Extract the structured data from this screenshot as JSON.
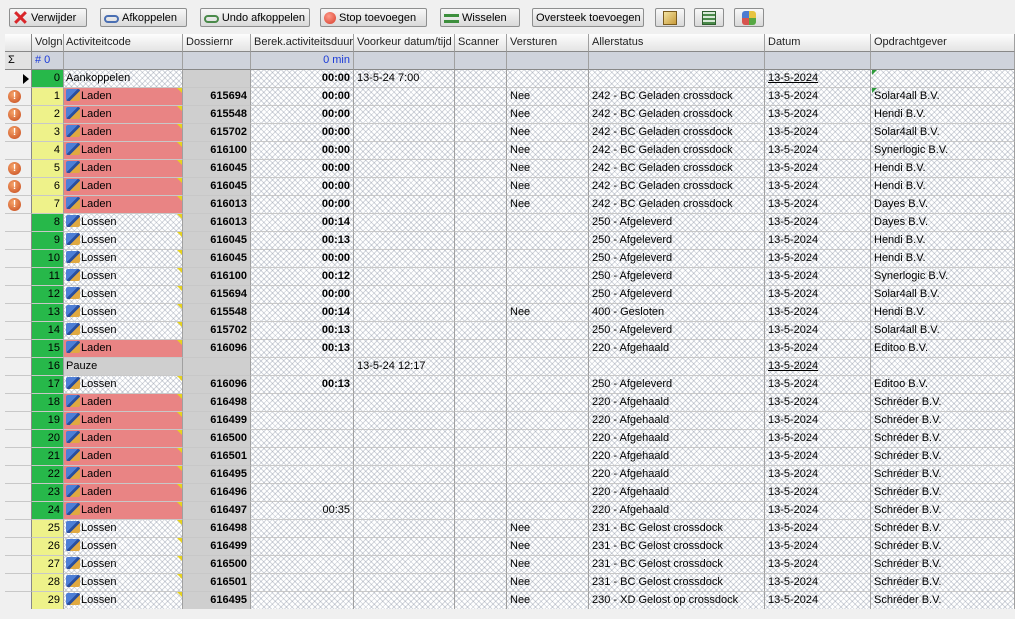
{
  "toolbar": {
    "buttons": [
      {
        "label": "Verwijder",
        "icon": "delete-icon"
      },
      {
        "label": "Afkoppelen",
        "icon": "uncouple-icon"
      },
      {
        "label": "Undo afkoppelen",
        "icon": "undo-uncouple-icon"
      },
      {
        "label": "Stop toevoegen",
        "icon": "stop-icon"
      },
      {
        "label": "Wisselen",
        "icon": "swap-icon"
      },
      {
        "label": "Oversteek toevoegen",
        "icon": ""
      },
      {
        "label": "",
        "icon": "document-icon"
      },
      {
        "label": "",
        "icon": "grid-icon"
      },
      {
        "label": "",
        "icon": "palette-icon"
      }
    ]
  },
  "grid": {
    "columns": [
      "Volgnr",
      "Activiteitcode",
      "Dossiernr",
      "Berek.activiteitsduur",
      "Voorkeur datum/tijd",
      "Scanner",
      "Versturen",
      "Allerstatus",
      "Datum",
      "Opdrachtgever"
    ],
    "summary": {
      "sigma": "Σ",
      "volg": "# 0",
      "duur": "0 min"
    },
    "rows": [
      {
        "volg": "0",
        "act": "Aankoppelen",
        "dos": "",
        "duur": "00:00",
        "voorkeur": "13-5-24 7:00",
        "versturen": "",
        "status": "",
        "datum": "13-5-2024",
        "opdrachtgever": "",
        "volgColor": "green",
        "actColor": "none",
        "warn": false,
        "truck": false,
        "current": true,
        "dateUnderline": true
      },
      {
        "volg": "1",
        "act": "Laden",
        "dos": "615694",
        "duur": "00:00",
        "voorkeur": "",
        "versturen": "Nee",
        "status": "242 - BC Geladen crossdock",
        "datum": "13-5-2024",
        "opdrachtgever": "Solar4all B.V.",
        "volgColor": "yellow",
        "actColor": "red",
        "warn": true,
        "truck": true
      },
      {
        "volg": "2",
        "act": "Laden",
        "dos": "615548",
        "duur": "00:00",
        "voorkeur": "",
        "versturen": "Nee",
        "status": "242 - BC Geladen crossdock",
        "datum": "13-5-2024",
        "opdrachtgever": "Hendi B.V.",
        "volgColor": "yellow",
        "actColor": "red",
        "warn": true,
        "truck": true
      },
      {
        "volg": "3",
        "act": "Laden",
        "dos": "615702",
        "duur": "00:00",
        "voorkeur": "",
        "versturen": "Nee",
        "status": "242 - BC Geladen crossdock",
        "datum": "13-5-2024",
        "opdrachtgever": "Solar4all B.V.",
        "volgColor": "yellow",
        "actColor": "red",
        "warn": true,
        "truck": true
      },
      {
        "volg": "4",
        "act": "Laden",
        "dos": "616100",
        "duur": "00:00",
        "voorkeur": "",
        "versturen": "Nee",
        "status": "242 - BC Geladen crossdock",
        "datum": "13-5-2024",
        "opdrachtgever": "Synerlogic B.V.",
        "volgColor": "yellow",
        "actColor": "red",
        "warn": false,
        "truck": true
      },
      {
        "volg": "5",
        "act": "Laden",
        "dos": "616045",
        "duur": "00:00",
        "voorkeur": "",
        "versturen": "Nee",
        "status": "242 - BC Geladen crossdock",
        "datum": "13-5-2024",
        "opdrachtgever": "Hendi B.V.",
        "volgColor": "yellow",
        "actColor": "red",
        "warn": true,
        "truck": true
      },
      {
        "volg": "6",
        "act": "Laden",
        "dos": "616045",
        "duur": "00:00",
        "voorkeur": "",
        "versturen": "Nee",
        "status": "242 - BC Geladen crossdock",
        "datum": "13-5-2024",
        "opdrachtgever": "Hendi B.V.",
        "volgColor": "yellow",
        "actColor": "red",
        "warn": true,
        "truck": true
      },
      {
        "volg": "7",
        "act": "Laden",
        "dos": "616013",
        "duur": "00:00",
        "voorkeur": "",
        "versturen": "Nee",
        "status": "242 - BC Geladen crossdock",
        "datum": "13-5-2024",
        "opdrachtgever": "Dayes B.V.",
        "volgColor": "yellow",
        "actColor": "red",
        "warn": true,
        "truck": true
      },
      {
        "volg": "8",
        "act": "Lossen",
        "dos": "616013",
        "duur": "00:14",
        "voorkeur": "",
        "versturen": "",
        "status": "250 - Afgeleverd",
        "datum": "13-5-2024",
        "opdrachtgever": "Dayes B.V.",
        "volgColor": "green",
        "actColor": "none",
        "warn": false,
        "truck": true
      },
      {
        "volg": "9",
        "act": "Lossen",
        "dos": "616045",
        "duur": "00:13",
        "voorkeur": "",
        "versturen": "",
        "status": "250 - Afgeleverd",
        "datum": "13-5-2024",
        "opdrachtgever": "Hendi B.V.",
        "volgColor": "green",
        "actColor": "none",
        "warn": false,
        "truck": true
      },
      {
        "volg": "10",
        "act": "Lossen",
        "dos": "616045",
        "duur": "00:00",
        "voorkeur": "",
        "versturen": "",
        "status": "250 - Afgeleverd",
        "datum": "13-5-2024",
        "opdrachtgever": "Hendi B.V.",
        "volgColor": "green",
        "actColor": "none",
        "warn": false,
        "truck": true
      },
      {
        "volg": "11",
        "act": "Lossen",
        "dos": "616100",
        "duur": "00:12",
        "voorkeur": "",
        "versturen": "",
        "status": "250 - Afgeleverd",
        "datum": "13-5-2024",
        "opdrachtgever": "Synerlogic B.V.",
        "volgColor": "green",
        "actColor": "none",
        "warn": false,
        "truck": true
      },
      {
        "volg": "12",
        "act": "Lossen",
        "dos": "615694",
        "duur": "00:00",
        "voorkeur": "",
        "versturen": "",
        "status": "250 - Afgeleverd",
        "datum": "13-5-2024",
        "opdrachtgever": "Solar4all B.V.",
        "volgColor": "green",
        "actColor": "none",
        "warn": false,
        "truck": true
      },
      {
        "volg": "13",
        "act": "Lossen",
        "dos": "615548",
        "duur": "00:14",
        "voorkeur": "",
        "versturen": "Nee",
        "status": "400 - Gesloten",
        "datum": "13-5-2024",
        "opdrachtgever": "Hendi B.V.",
        "volgColor": "green",
        "actColor": "none",
        "warn": false,
        "truck": true
      },
      {
        "volg": "14",
        "act": "Lossen",
        "dos": "615702",
        "duur": "00:13",
        "voorkeur": "",
        "versturen": "",
        "status": "250 - Afgeleverd",
        "datum": "13-5-2024",
        "opdrachtgever": "Solar4all B.V.",
        "volgColor": "green",
        "actColor": "none",
        "warn": false,
        "truck": true
      },
      {
        "volg": "15",
        "act": "Laden",
        "dos": "616096",
        "duur": "00:13",
        "voorkeur": "",
        "versturen": "",
        "status": "220 - Afgehaald",
        "datum": "13-5-2024",
        "opdrachtgever": "Editoo B.V.",
        "volgColor": "green",
        "actColor": "red",
        "warn": false,
        "truck": true
      },
      {
        "volg": "16",
        "act": "Pauze",
        "dos": "",
        "duur": "",
        "voorkeur": "13-5-24 12:17",
        "versturen": "",
        "status": "",
        "datum": "13-5-2024",
        "opdrachtgever": "",
        "volgColor": "green",
        "actColor": "grey",
        "warn": false,
        "truck": false,
        "dateUnderline": true
      },
      {
        "volg": "17",
        "act": "Lossen",
        "dos": "616096",
        "duur": "00:13",
        "voorkeur": "",
        "versturen": "",
        "status": "250 - Afgeleverd",
        "datum": "13-5-2024",
        "opdrachtgever": "Editoo B.V.",
        "volgColor": "green",
        "actColor": "none",
        "warn": false,
        "truck": true
      },
      {
        "volg": "18",
        "act": "Laden",
        "dos": "616498",
        "duur": "",
        "voorkeur": "",
        "versturen": "",
        "status": "220 - Afgehaald",
        "datum": "13-5-2024",
        "opdrachtgever": "Schréder B.V.",
        "volgColor": "green",
        "actColor": "red",
        "warn": false,
        "truck": true
      },
      {
        "volg": "19",
        "act": "Laden",
        "dos": "616499",
        "duur": "",
        "voorkeur": "",
        "versturen": "",
        "status": "220 - Afgehaald",
        "datum": "13-5-2024",
        "opdrachtgever": "Schréder B.V.",
        "volgColor": "green",
        "actColor": "red",
        "warn": false,
        "truck": true
      },
      {
        "volg": "20",
        "act": "Laden",
        "dos": "616500",
        "duur": "",
        "voorkeur": "",
        "versturen": "",
        "status": "220 - Afgehaald",
        "datum": "13-5-2024",
        "opdrachtgever": "Schréder B.V.",
        "volgColor": "green",
        "actColor": "red",
        "warn": false,
        "truck": true
      },
      {
        "volg": "21",
        "act": "Laden",
        "dos": "616501",
        "duur": "",
        "voorkeur": "",
        "versturen": "",
        "status": "220 - Afgehaald",
        "datum": "13-5-2024",
        "opdrachtgever": "Schréder B.V.",
        "volgColor": "green",
        "actColor": "red",
        "warn": false,
        "truck": true
      },
      {
        "volg": "22",
        "act": "Laden",
        "dos": "616495",
        "duur": "",
        "voorkeur": "",
        "versturen": "",
        "status": "220 - Afgehaald",
        "datum": "13-5-2024",
        "opdrachtgever": "Schréder B.V.",
        "volgColor": "green",
        "actColor": "red",
        "warn": false,
        "truck": true
      },
      {
        "volg": "23",
        "act": "Laden",
        "dos": "616496",
        "duur": "",
        "voorkeur": "",
        "versturen": "",
        "status": "220 - Afgehaald",
        "datum": "13-5-2024",
        "opdrachtgever": "Schréder B.V.",
        "volgColor": "green",
        "actColor": "red",
        "warn": false,
        "truck": true
      },
      {
        "volg": "24",
        "act": "Laden",
        "dos": "616497",
        "duur": "00:35",
        "voorkeur": "",
        "versturen": "",
        "status": "220 - Afgehaald",
        "datum": "13-5-2024",
        "opdrachtgever": "Schréder B.V.",
        "volgColor": "green",
        "actColor": "red",
        "warn": false,
        "truck": true,
        "plainDuur": true
      },
      {
        "volg": "25",
        "act": "Lossen",
        "dos": "616498",
        "duur": "",
        "voorkeur": "",
        "versturen": "Nee",
        "status": "231 - BC Gelost crossdock",
        "datum": "13-5-2024",
        "opdrachtgever": "Schréder B.V.",
        "volgColor": "yellow",
        "actColor": "none",
        "warn": false,
        "truck": true
      },
      {
        "volg": "26",
        "act": "Lossen",
        "dos": "616499",
        "duur": "",
        "voorkeur": "",
        "versturen": "Nee",
        "status": "231 - BC Gelost crossdock",
        "datum": "13-5-2024",
        "opdrachtgever": "Schréder B.V.",
        "volgColor": "yellow",
        "actColor": "none",
        "warn": false,
        "truck": true
      },
      {
        "volg": "27",
        "act": "Lossen",
        "dos": "616500",
        "duur": "",
        "voorkeur": "",
        "versturen": "Nee",
        "status": "231 - BC Gelost crossdock",
        "datum": "13-5-2024",
        "opdrachtgever": "Schréder B.V.",
        "volgColor": "yellow",
        "actColor": "none",
        "warn": false,
        "truck": true
      },
      {
        "volg": "28",
        "act": "Lossen",
        "dos": "616501",
        "duur": "",
        "voorkeur": "",
        "versturen": "Nee",
        "status": "231 - BC Gelost crossdock",
        "datum": "13-5-2024",
        "opdrachtgever": "Schréder B.V.",
        "volgColor": "yellow",
        "actColor": "none",
        "warn": false,
        "truck": true
      },
      {
        "volg": "29",
        "act": "Lossen",
        "dos": "616495",
        "duur": "",
        "voorkeur": "",
        "versturen": "Nee",
        "status": "230 - XD Gelost op crossdock",
        "datum": "13-5-2024",
        "opdrachtgever": "Schréder B.V.",
        "volgColor": "yellow",
        "actColor": "none",
        "warn": false,
        "truck": true
      }
    ]
  }
}
